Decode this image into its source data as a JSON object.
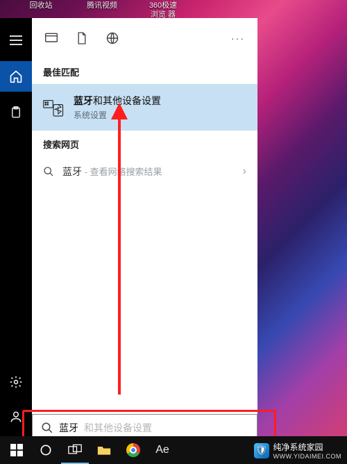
{
  "desktop_icons": {
    "recycle": "回收站",
    "tencent_video": "腾讯视频",
    "browser360": "360极速浏览\n器"
  },
  "sidenav": {
    "menu": "menu",
    "home": "home",
    "clipboard": "clipboard",
    "settings": "settings",
    "account": "account"
  },
  "tabs": {
    "apps": "apps",
    "documents": "documents",
    "web": "web",
    "more": "···"
  },
  "sections": {
    "best_match": "最佳匹配",
    "search_web": "搜索网页"
  },
  "best_match": {
    "title_bold": "蓝牙",
    "title_rest": "和其他设备设置",
    "subtitle": "系统设置"
  },
  "web_suggestion": {
    "query": "蓝牙",
    "hint": " - 查看网络搜索结果",
    "chevron": "›"
  },
  "search": {
    "typed": "蓝牙",
    "ghost": "和其他设备设置"
  },
  "watermark": {
    "brand": "纯净系统家园",
    "url": "WWW.YIDAIMEI.COM"
  }
}
